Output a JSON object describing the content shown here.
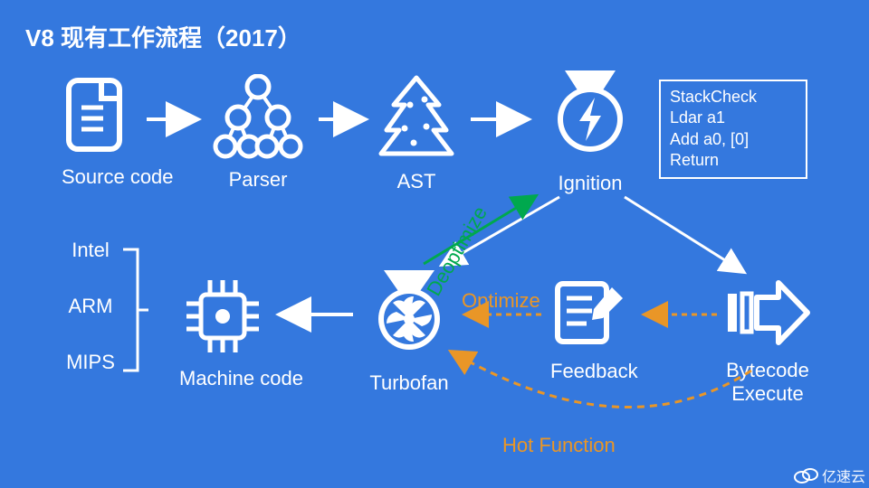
{
  "title": "V8 现有工作流程（2017）",
  "nodes": {
    "source": {
      "label": "Source code"
    },
    "parser": {
      "label": "Parser"
    },
    "ast": {
      "label": "AST"
    },
    "ignition": {
      "label": "Ignition"
    },
    "machine": {
      "label": "Machine code"
    },
    "turbofan": {
      "label": "Turbofan"
    },
    "feedback": {
      "label": "Feedback"
    },
    "bytecode": {
      "label": "Bytecode\nExecute"
    }
  },
  "arch": {
    "intel": "Intel",
    "arm": "ARM",
    "mips": "MIPS"
  },
  "code_box": {
    "l1": "StackCheck",
    "l2": "Ldar a1",
    "l3": "Add a0, [0]",
    "l4": "Return"
  },
  "edges": {
    "deoptimize": "Deoptimize",
    "optimize": "Optimize",
    "hot": "Hot Function"
  },
  "watermark": "亿速云"
}
